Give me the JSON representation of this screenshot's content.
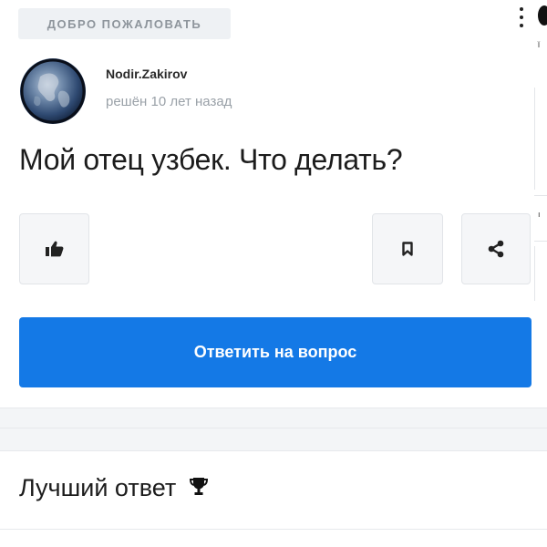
{
  "header": {
    "welcome_label": "ДОБРО ПОЖАЛОВАТЬ"
  },
  "post": {
    "author": {
      "username": "Nodir.Zakirov",
      "avatar_icon": "earth-globe-avatar"
    },
    "status_time": "решён 10 лет назад",
    "question": "Мой отец узбек. Что делать?"
  },
  "actions": {
    "like_icon": "thumbs-up-icon",
    "bookmark_icon": "bookmark-icon",
    "share_icon": "share-icon",
    "answer_button_label": "Ответить на вопрос"
  },
  "best_answer": {
    "heading": "Лучший ответ",
    "icon": "trophy-icon"
  },
  "colors": {
    "primary_button": "#1479e6",
    "muted_text": "#9aa1a8",
    "badge_background": "#eef1f4"
  }
}
